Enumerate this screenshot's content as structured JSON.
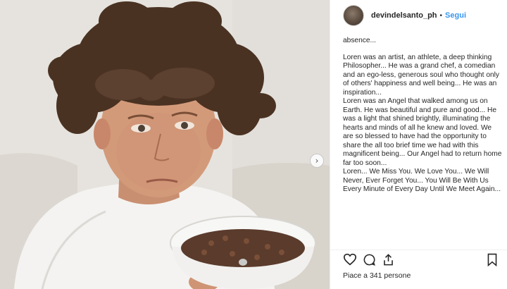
{
  "post": {
    "username": "devindelsanto_ph",
    "separator": "•",
    "follow_label": "Segui",
    "caption": [
      "absence...",
      "Loren was an artist, an athlete, a deep thinking Philosopher... He was a grand chef, a comedian and an ego-less, generous soul who thought only of others' happiness and well being... He was an inspiration...",
      "Loren was an Angel that walked among us on Earth. He was beautiful and pure and good... He was a light that shined brightly, illuminating the hearts and minds of all he knew and loved. We are so blessed to have had the opportunity to share the all too brief time we had with this magnificent being... Our Angel had to return home far too soon...",
      "Loren... We Miss You. We Love You... We Will Never, Ever Forget You... You Will Be With Us Every Minute of Every Day Until We Meet Again..."
    ],
    "likes_text": "Piace a 341 persone",
    "next_arrow": "›"
  },
  "icons": {
    "like": "heart-icon",
    "comment": "comment-icon",
    "share": "share-icon",
    "save": "bookmark-icon",
    "next": "chevron-right-icon"
  },
  "colors": {
    "follow": "#3897f0",
    "text": "#262626",
    "border": "#efefef"
  }
}
